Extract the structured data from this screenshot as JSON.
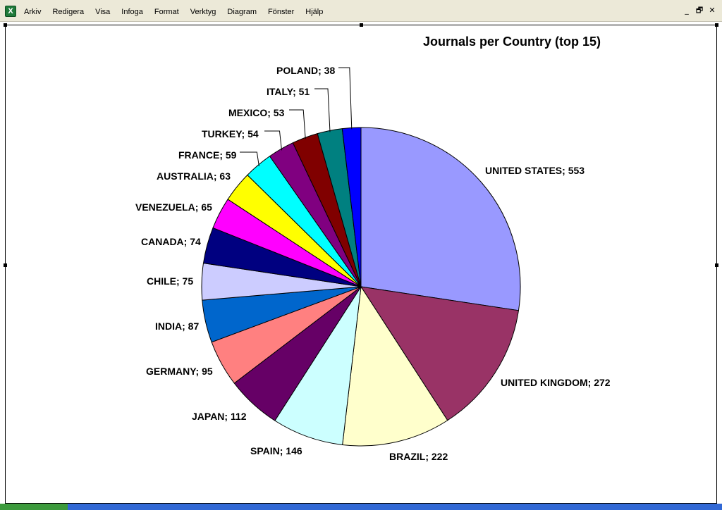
{
  "menubar": {
    "items": [
      "Arkiv",
      "Redigera",
      "Visa",
      "Infoga",
      "Format",
      "Verktyg",
      "Diagram",
      "Fönster",
      "Hjälp"
    ],
    "controls": [
      "_",
      "🗗",
      "✕"
    ]
  },
  "chart_data": {
    "type": "pie",
    "title": "Journals per Country (top 15)",
    "categories": [
      "UNITED STATES",
      "UNITED KINGDOM",
      "BRAZIL",
      "SPAIN",
      "JAPAN",
      "GERMANY",
      "INDIA",
      "CHILE",
      "CANADA",
      "VENEZUELA",
      "AUSTRALIA",
      "FRANCE",
      "TURKEY",
      "MEXICO",
      "ITALY",
      "POLAND"
    ],
    "values": [
      553,
      272,
      222,
      146,
      112,
      95,
      87,
      75,
      74,
      65,
      63,
      59,
      54,
      53,
      51,
      38
    ],
    "labels": [
      "UNITED STATES; 553",
      "UNITED KINGDOM; 272",
      "BRAZIL; 222",
      "SPAIN; 146",
      "JAPAN; 112",
      "GERMANY; 95",
      "INDIA; 87",
      "CHILE; 75",
      "CANADA; 74",
      "VENEZUELA; 65",
      "AUSTRALIA; 63",
      "FRANCE; 59",
      "TURKEY; 54",
      "MEXICO; 53",
      "ITALY; 51",
      "POLAND; 38"
    ],
    "colors": [
      "#9999ff",
      "#993366",
      "#ffffcc",
      "#ccffff",
      "#660066",
      "#ff8080",
      "#0066cc",
      "#ccccff",
      "#000080",
      "#ff00ff",
      "#ffff00",
      "#00ffff",
      "#800080",
      "#800000",
      "#008080",
      "#0000ff"
    ],
    "start_angle": "12 o'clock",
    "direction": "clockwise",
    "legend": "none",
    "data_labels": "category; value"
  }
}
